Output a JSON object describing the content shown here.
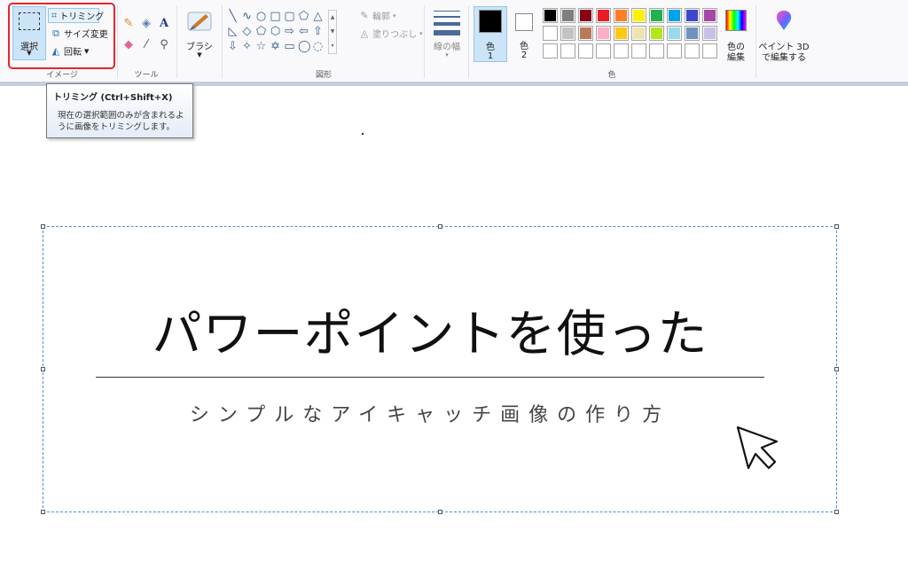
{
  "ribbon": {
    "image_group": {
      "label": "イメージ",
      "select_label": "選択",
      "trim_label": "トリミング",
      "resize_label": "サイズ変更",
      "rotate_label": "回転"
    },
    "tools_group": {
      "label": "ツール"
    },
    "brush_label": "ブラシ",
    "shapes_group": {
      "label": "図形",
      "outline_label": "輪郭",
      "fill_label": "塗りつぶし"
    },
    "line_width_label": "線の幅",
    "color1_label": "色",
    "color1_num": "1",
    "color2_label": "色",
    "color2_num": "2",
    "colors_group_label": "色",
    "edit_colors_label_1": "色の",
    "edit_colors_label_2": "編集",
    "paint3d_label_1": "ペイント 3D",
    "paint3d_label_2": "で編集する",
    "color1_value": "#000000",
    "color2_value": "#ffffff",
    "palette_row1": [
      "#000000",
      "#7f7f7f",
      "#880015",
      "#ed1c24",
      "#ff7f27",
      "#fff200",
      "#22b14c",
      "#00a2e8",
      "#3f48cc",
      "#a349a4"
    ],
    "palette_row2": [
      "#ffffff",
      "#c3c3c3",
      "#b97a57",
      "#ffaec9",
      "#ffc90e",
      "#efe4b0",
      "#b5e61d",
      "#99d9ea",
      "#7092be",
      "#c8bfe7"
    ],
    "palette_row3": [
      "#ffffff",
      "#ffffff",
      "#ffffff",
      "#ffffff",
      "#ffffff",
      "#ffffff",
      "#ffffff",
      "#ffffff",
      "#ffffff",
      "#ffffff"
    ]
  },
  "tooltip": {
    "title": "トリミング (Ctrl+Shift+X)",
    "description": "現在の選択範囲のみが含まれるように画像をトリミングします。"
  },
  "canvas": {
    "title": "パワーポイントを使った",
    "subtitle": "シンプルなアイキャッチ画像の作り方"
  }
}
